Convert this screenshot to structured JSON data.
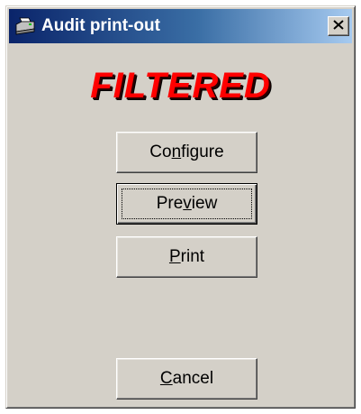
{
  "window": {
    "title": "Audit print-out",
    "close_glyph": "✕"
  },
  "status": {
    "text": "FILTERED",
    "color": "#ff0000"
  },
  "buttons": {
    "configure": {
      "before": "Co",
      "mnemonic": "n",
      "after": "figure",
      "label": "Configure"
    },
    "preview": {
      "before": "Pre",
      "mnemonic": "v",
      "after": "iew",
      "label": "Preview"
    },
    "print": {
      "before": "",
      "mnemonic": "P",
      "after": "rint",
      "label": "Print"
    },
    "cancel": {
      "before": "",
      "mnemonic": "C",
      "after": "ancel",
      "label": "Cancel"
    }
  },
  "icons": {
    "app": "printer-icon",
    "close": "close-icon"
  },
  "colors": {
    "dialog_face": "#d4d0c8",
    "titlebar_start": "#0a246a",
    "titlebar_end": "#a6caf0"
  }
}
